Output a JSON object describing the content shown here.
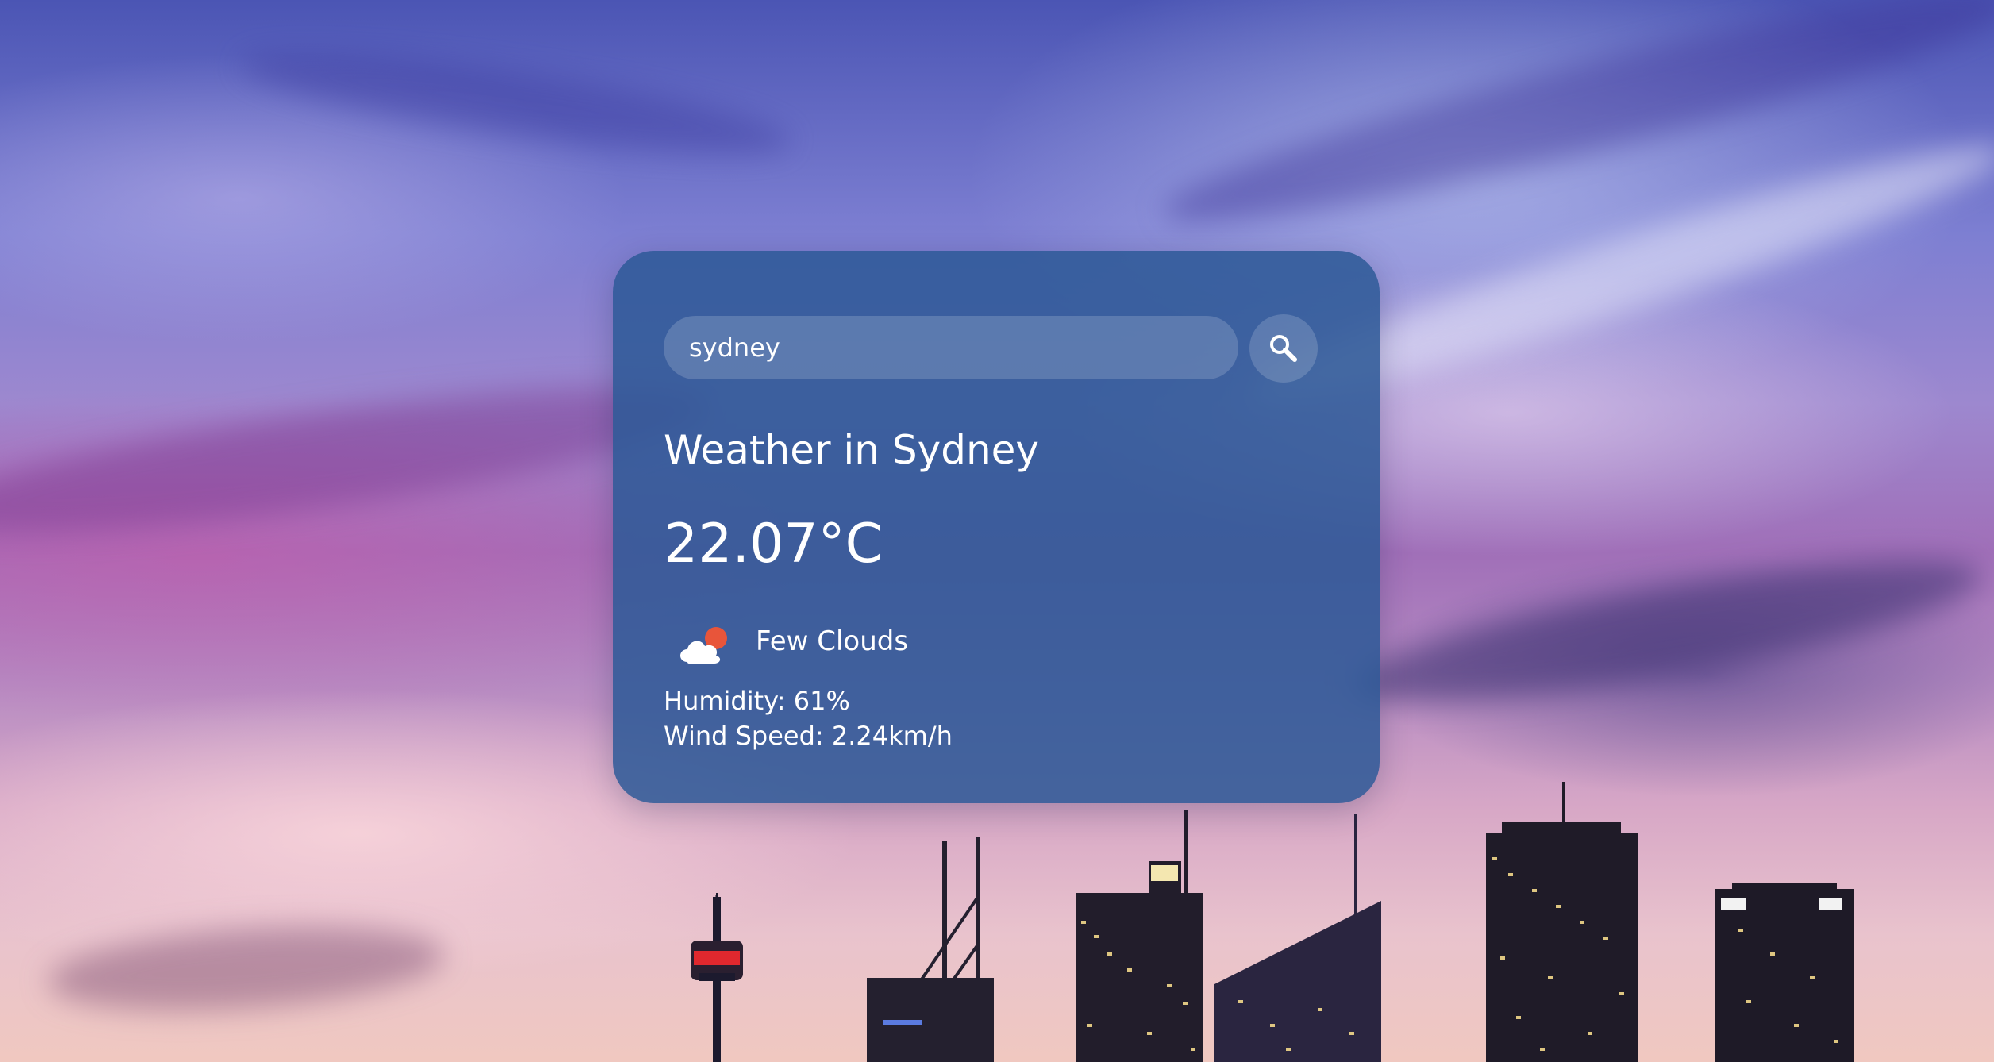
{
  "search": {
    "value": "sydney",
    "button_icon": "search-icon"
  },
  "weather": {
    "title": "Weather in Sydney",
    "temperature": "22.07°C",
    "icon": "few-clouds-icon",
    "description": "Few Clouds",
    "humidity": "Humidity: 61%",
    "wind": "Wind Speed: 2.24km/h"
  },
  "colors": {
    "card": "#2c5896",
    "text": "#ffffff",
    "sun": "#e8553a"
  }
}
